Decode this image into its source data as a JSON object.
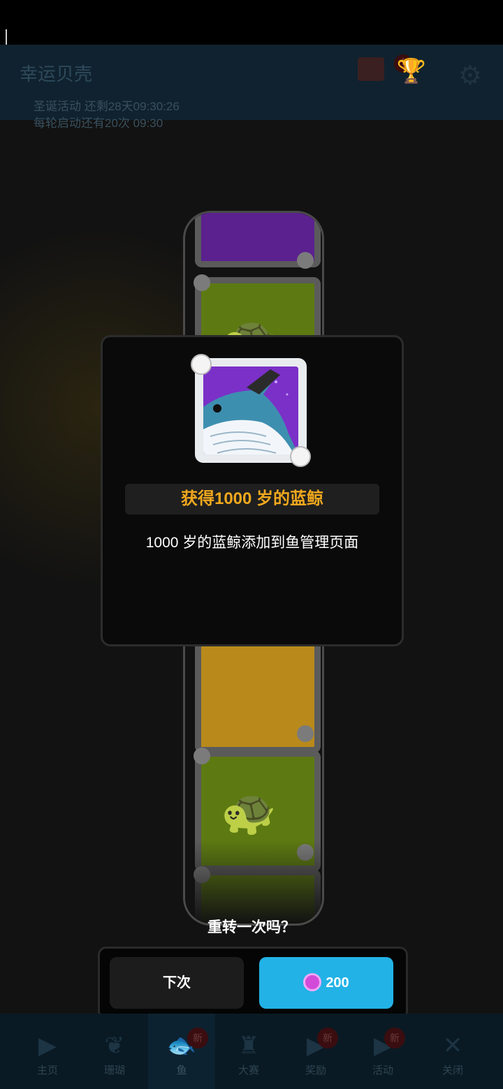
{
  "background": {
    "app_title": "幸运贝壳",
    "event_1": "圣诞活动 还剩28天09:30:26",
    "event_2": "每轮启动还有20次 09:30"
  },
  "tabbar": {
    "tabs": [
      {
        "icon": "play-icon",
        "label": "主页",
        "badge": ""
      },
      {
        "icon": "coral-icon",
        "label": "珊瑚",
        "badge": ""
      },
      {
        "icon": "fish-icon",
        "label": "鱼",
        "badge": "新",
        "active": true
      },
      {
        "icon": "arena-icon",
        "label": "大赛",
        "badge": ""
      },
      {
        "icon": "play-icon",
        "label": "奖励",
        "badge": "新"
      },
      {
        "icon": "play-icon",
        "label": "活动",
        "badge": "新"
      },
      {
        "icon": "close-icon",
        "label": "关闭",
        "badge": ""
      }
    ]
  },
  "modal": {
    "reward_title": "获得1000 岁的蓝鲸",
    "reward_desc": "1000 岁的蓝鲸添加到鱼管理页面",
    "reward_icon": "blue-whale-card"
  },
  "respin": {
    "question": "重转一次吗？",
    "later_label": "下次",
    "spin_cost": "200",
    "currency_icon": "pearl-icon",
    "spin_color": "#22b2e6"
  },
  "colors": {
    "reward_title": "#f0a81d",
    "purple_card": "#7b30c8",
    "green_card": "#5d7a12"
  }
}
